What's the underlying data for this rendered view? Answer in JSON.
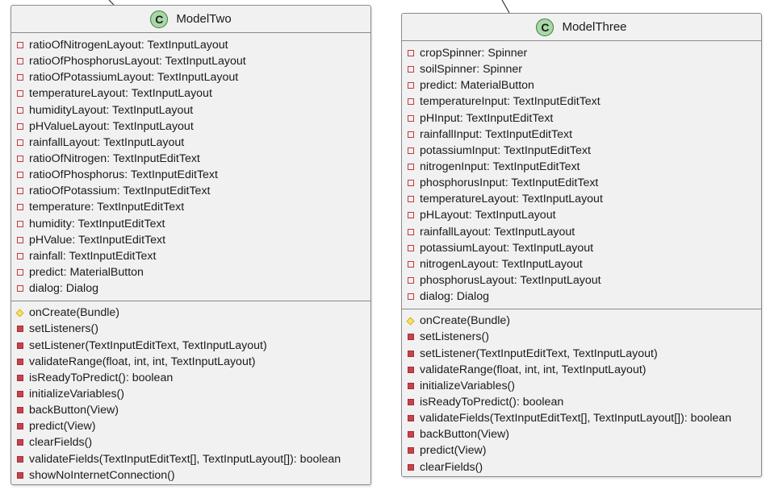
{
  "diagram": {
    "classes": [
      {
        "badge": "C",
        "name": "ModelTwo",
        "attributes": [
          "ratioOfNitrogenLayout: TextInputLayout",
          "ratioOfPhosphorusLayout: TextInputLayout",
          "ratioOfPotassiumLayout: TextInputLayout",
          "temperatureLayout: TextInputLayout",
          "humidityLayout: TextInputLayout",
          "pHValueLayout: TextInputLayout",
          "rainfallLayout: TextInputLayout",
          "ratioOfNitrogen: TextInputEditText",
          "ratioOfPhosphorus: TextInputEditText",
          "ratioOfPotassium: TextInputEditText",
          "temperature: TextInputEditText",
          "humidity: TextInputEditText",
          "pHValue: TextInputEditText",
          "rainfall: TextInputEditText",
          "predict: MaterialButton",
          "dialog: Dialog"
        ],
        "operations": [
          {
            "visibility": "protected",
            "text": "onCreate(Bundle)"
          },
          {
            "visibility": "private",
            "text": "setListeners()"
          },
          {
            "visibility": "private",
            "text": "setListener(TextInputEditText, TextInputLayout)"
          },
          {
            "visibility": "private",
            "text": "validateRange(float, int, int, TextInputLayout)"
          },
          {
            "visibility": "private",
            "text": "isReadyToPredict(): boolean"
          },
          {
            "visibility": "private",
            "text": "initializeVariables()"
          },
          {
            "visibility": "private",
            "text": "backButton(View)"
          },
          {
            "visibility": "private",
            "text": "predict(View)"
          },
          {
            "visibility": "private",
            "text": "clearFields()"
          },
          {
            "visibility": "private",
            "text": "validateFields(TextInputEditText[], TextInputLayout[]): boolean"
          },
          {
            "visibility": "private",
            "text": "showNoInternetConnection()"
          }
        ]
      },
      {
        "badge": "C",
        "name": "ModelThree",
        "attributes": [
          "cropSpinner: Spinner",
          "soilSpinner: Spinner",
          "predict: MaterialButton",
          "temperatureInput: TextInputEditText",
          "pHInput: TextInputEditText",
          "rainfallInput: TextInputEditText",
          "potassiumInput: TextInputEditText",
          "nitrogenInput: TextInputEditText",
          "phosphorusInput: TextInputEditText",
          "temperatureLayout: TextInputLayout",
          "pHLayout: TextInputLayout",
          "rainfallLayout: TextInputLayout",
          "potassiumLayout: TextInputLayout",
          "nitrogenLayout: TextInputLayout",
          "phosphorusLayout: TextInputLayout",
          "dialog: Dialog"
        ],
        "operations": [
          {
            "visibility": "protected",
            "text": "onCreate(Bundle)"
          },
          {
            "visibility": "private",
            "text": "setListeners()"
          },
          {
            "visibility": "private",
            "text": "setListener(TextInputEditText, TextInputLayout)"
          },
          {
            "visibility": "private",
            "text": "validateRange(float, int, int, TextInputLayout)"
          },
          {
            "visibility": "private",
            "text": "initializeVariables()"
          },
          {
            "visibility": "private",
            "text": "isReadyToPredict(): boolean"
          },
          {
            "visibility": "private",
            "text": "validateFields(TextInputEditText[], TextInputLayout[]): boolean"
          },
          {
            "visibility": "private",
            "text": "backButton(View)"
          },
          {
            "visibility": "private",
            "text": "predict(View)"
          },
          {
            "visibility": "private",
            "text": "clearFields()"
          }
        ]
      }
    ]
  }
}
